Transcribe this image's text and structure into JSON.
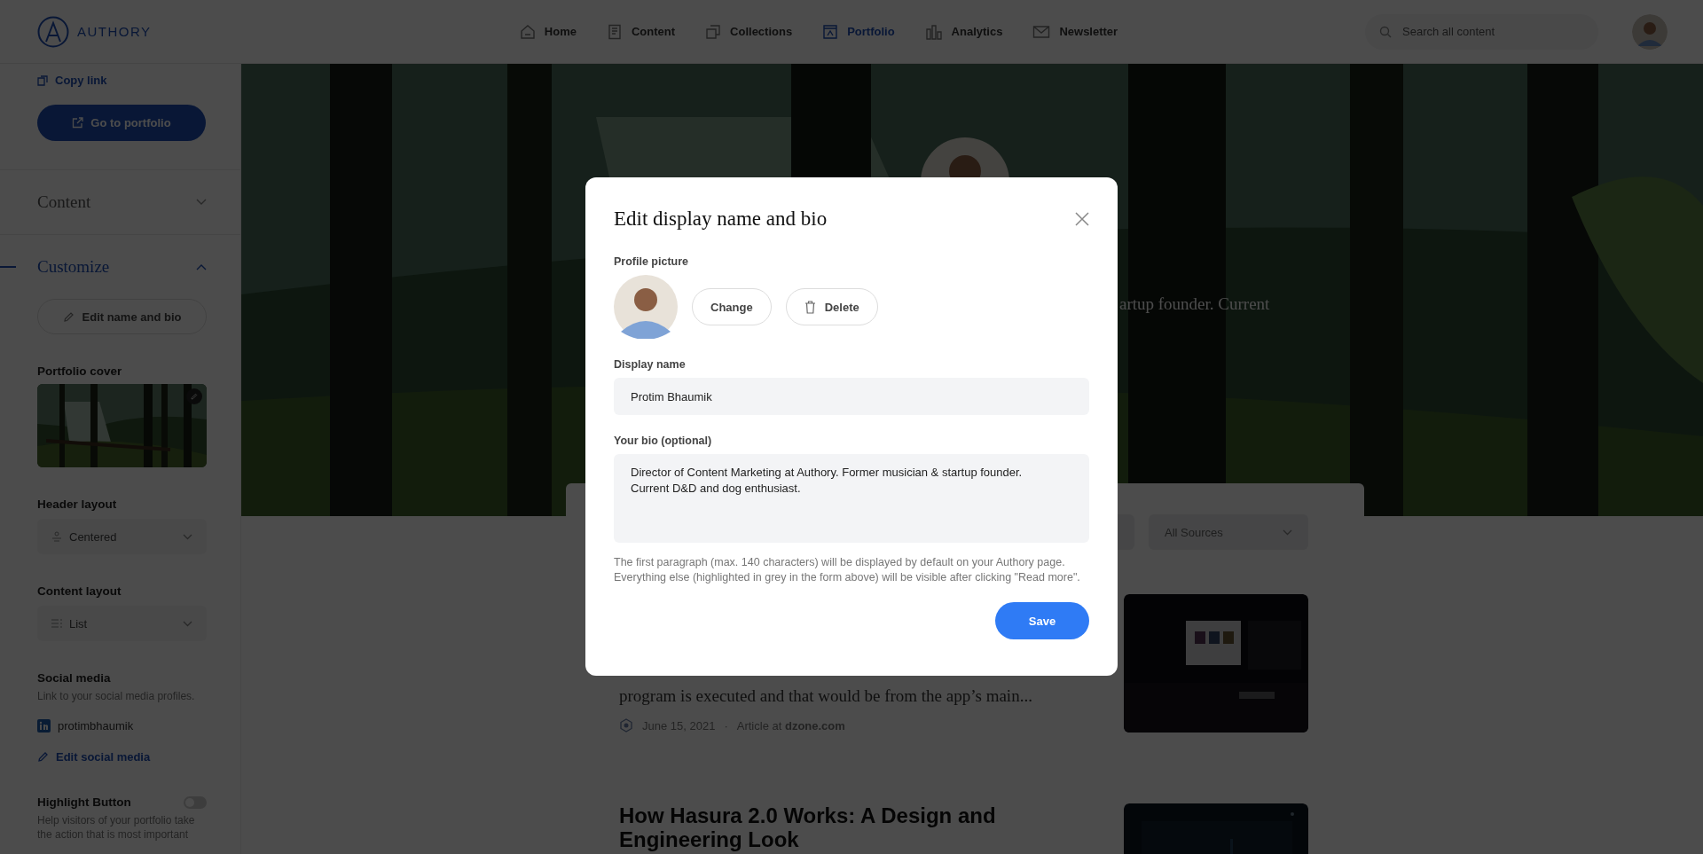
{
  "nav": {
    "logo": "AUTHORY",
    "items": [
      {
        "label": "Home",
        "selected": false
      },
      {
        "label": "Content",
        "selected": false
      },
      {
        "label": "Collections",
        "selected": false
      },
      {
        "label": "Portfolio",
        "selected": true
      },
      {
        "label": "Analytics",
        "selected": false
      },
      {
        "label": "Newsletter",
        "selected": false
      }
    ],
    "search": {
      "placeholder": "Search all content"
    }
  },
  "sidebar": {
    "copy_link": "Copy link",
    "go_button": "Go to portfolio",
    "sections": [
      {
        "title": "Content",
        "expanded": false
      },
      {
        "title": "Customize",
        "expanded": true
      }
    ],
    "edit_button": "Edit name and bio",
    "cover_label": "Portfolio cover",
    "header_layout": {
      "label": "Header layout",
      "value": "Centered"
    },
    "content_layout": {
      "label": "Content layout",
      "value": "List"
    },
    "social": {
      "title": "Social media",
      "hint": "Link to your social media profiles.",
      "handle": "protimbhaumik",
      "edit": "Edit social media"
    },
    "highlight": {
      "label": "Highlight Button",
      "on": false,
      "hint": "Help visitors of your portfolio take the action that is most important"
    }
  },
  "portfolio": {
    "bio_fragment": "artup founder. Current",
    "filter": "All Sources",
    "article": {
      "excerpt": "program is executed and that would be from the app’s main...",
      "date": "June 15, 2021",
      "separator": "·",
      "source": "Article at **dzone.com**"
    },
    "next_article": {
      "title": "How Hasura 2.0 Works: A Design and Engineering Look"
    }
  },
  "modal": {
    "title": "Edit display name and bio",
    "picture_label": "Profile picture",
    "change": "Change",
    "delete": "Delete",
    "name_label": "Display name",
    "name_value": "Protim Bhaumik",
    "bio_label": "Your bio (optional)",
    "bio_value": "Director of Content Marketing at Authory. Former musician & startup founder.\nCurrent D&D and dog enthusiast.",
    "hint": "The first paragraph (max. 140 characters) will be displayed by default on your Authory page. Everything else (highlighted in grey in the form above) will be visible after clicking \"Read more\".",
    "save": "Save"
  }
}
